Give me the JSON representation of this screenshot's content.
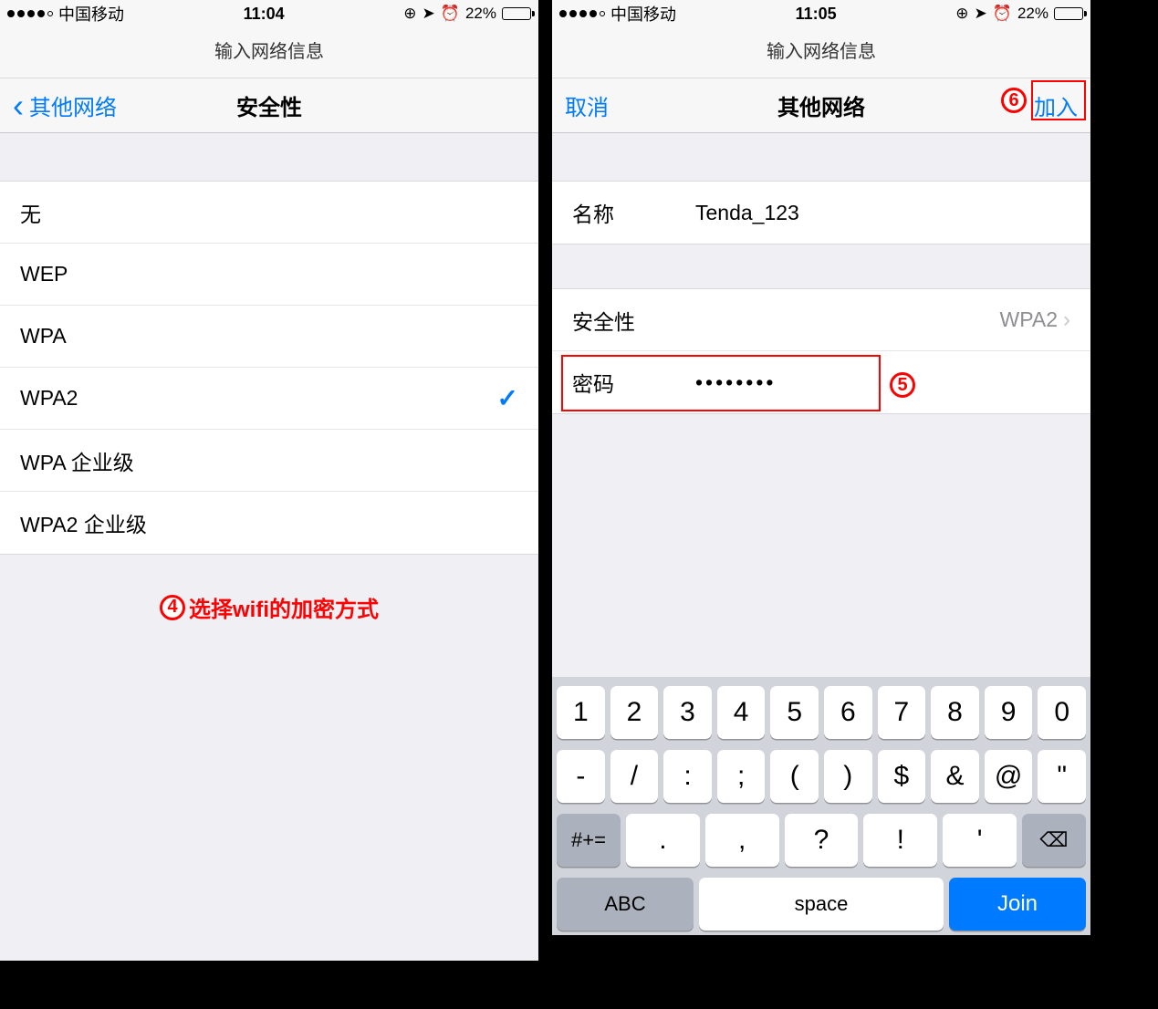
{
  "left": {
    "status": {
      "carrier": "中国移动",
      "time": "11:04",
      "battery_pct": "22%"
    },
    "subheader": "输入网络信息",
    "nav": {
      "back_label": "其他网络",
      "title": "安全性"
    },
    "security_options": [
      {
        "label": "无",
        "selected": false
      },
      {
        "label": "WEP",
        "selected": false
      },
      {
        "label": "WPA",
        "selected": false
      },
      {
        "label": "WPA2",
        "selected": true
      },
      {
        "label": "WPA 企业级",
        "selected": false
      },
      {
        "label": "WPA2 企业级",
        "selected": false
      }
    ],
    "annotation": {
      "num": "4",
      "text": "选择wifi的加密方式"
    }
  },
  "right": {
    "status": {
      "carrier": "中国移动",
      "time": "11:05",
      "battery_pct": "22%"
    },
    "subheader": "输入网络信息",
    "nav": {
      "cancel_label": "取消",
      "title": "其他网络",
      "join_label": "加入"
    },
    "fields": {
      "name_label": "名称",
      "name_value": "Tenda_123",
      "security_label": "安全性",
      "security_value": "WPA2",
      "password_label": "密码",
      "password_value": "••••••••"
    },
    "annotations": {
      "five": "5",
      "six": "6"
    },
    "keyboard": {
      "row1": [
        "1",
        "2",
        "3",
        "4",
        "5",
        "6",
        "7",
        "8",
        "9",
        "0"
      ],
      "row2": [
        "-",
        "/",
        ":",
        ";",
        "(",
        ")",
        "$",
        "&",
        "@",
        "\""
      ],
      "row3_special": "#+=",
      "row3": [
        ".",
        ",",
        "?",
        "!",
        "'"
      ],
      "row3_del": "⌫",
      "row4_abc": "ABC",
      "row4_space": "space",
      "row4_join": "Join"
    }
  }
}
